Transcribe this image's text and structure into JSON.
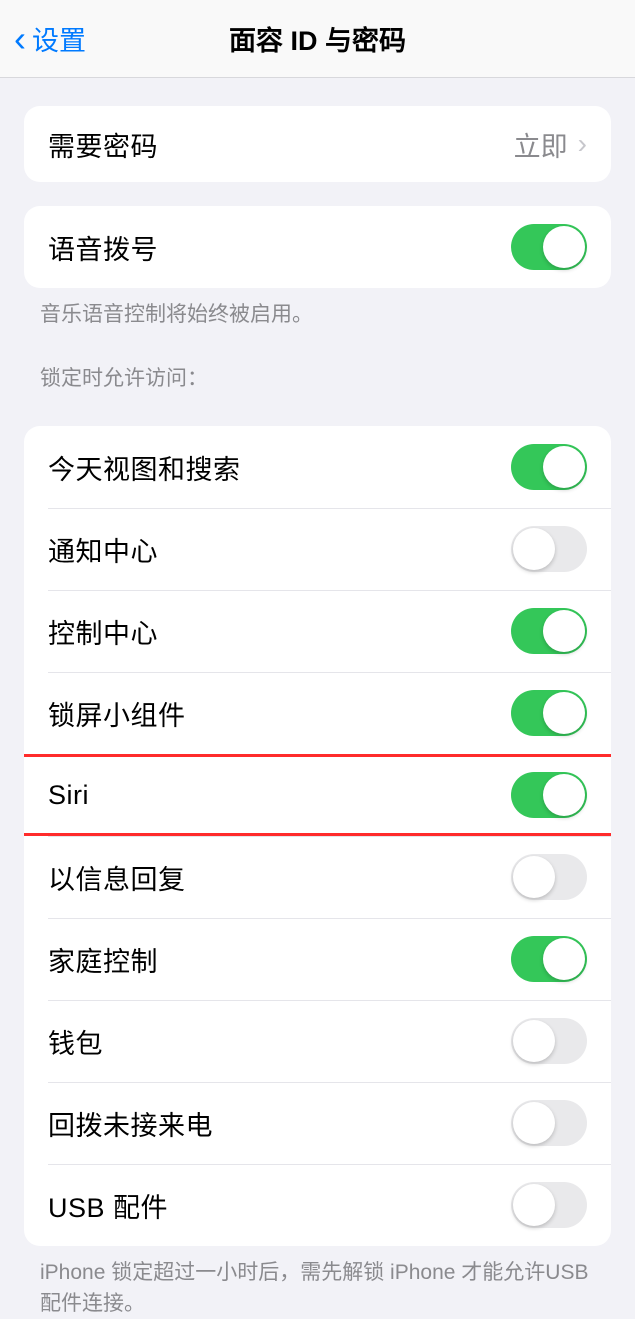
{
  "header": {
    "back_label": "设置",
    "title": "面容 ID 与密码"
  },
  "group_require": {
    "label": "需要密码",
    "value": "立即"
  },
  "group_voice": {
    "label": "语音拨号",
    "enabled": true,
    "footer": "音乐语音控制将始终被启用。"
  },
  "lock_section_header": "锁定时允许访问：",
  "lock_items": [
    {
      "label": "今天视图和搜索",
      "enabled": true
    },
    {
      "label": "通知中心",
      "enabled": false
    },
    {
      "label": "控制中心",
      "enabled": true
    },
    {
      "label": "锁屏小组件",
      "enabled": true
    },
    {
      "label": "Siri",
      "enabled": true
    },
    {
      "label": "以信息回复",
      "enabled": false
    },
    {
      "label": "家庭控制",
      "enabled": true
    },
    {
      "label": "钱包",
      "enabled": false
    },
    {
      "label": "回拨未接来电",
      "enabled": false
    },
    {
      "label": "USB 配件",
      "enabled": false
    }
  ],
  "lock_footer": "iPhone 锁定超过一小时后，需先解锁 iPhone 才能允许USB 配件连接。"
}
